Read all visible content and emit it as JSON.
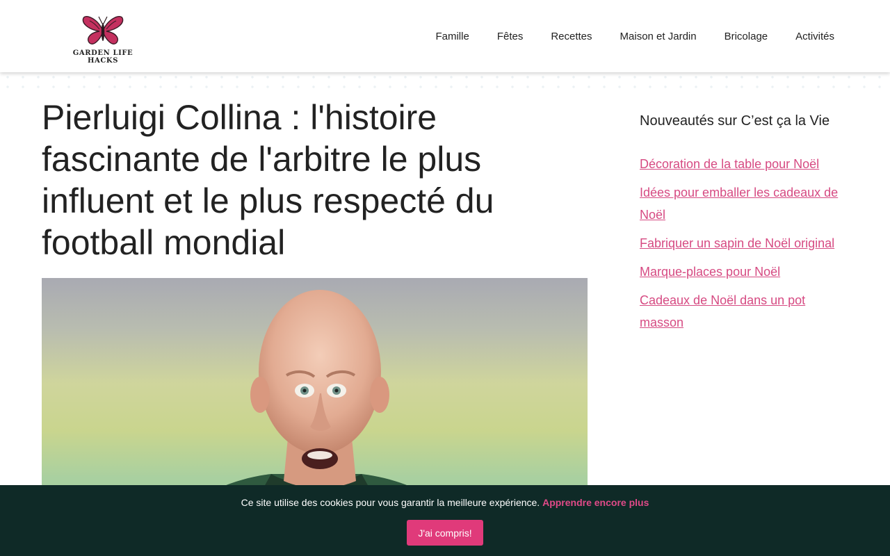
{
  "brand": {
    "logo_text": "GARDEN LIFE HACKS",
    "colors": {
      "accent": "#e03a7a",
      "link": "#d64a82",
      "cookie_bg": "#0f2a27"
    }
  },
  "nav": {
    "items": [
      {
        "label": "Famille"
      },
      {
        "label": "Fêtes"
      },
      {
        "label": "Recettes"
      },
      {
        "label": "Maison et Jardin"
      },
      {
        "label": "Bricolage"
      },
      {
        "label": "Activités"
      }
    ]
  },
  "article": {
    "title": "Pierluigi Collina : l'histoire fascinante de l'arbitre le plus influent et le plus respecté du football mondial"
  },
  "sidebar": {
    "title": "Nouveautés sur C’est ça la Vie",
    "links": [
      {
        "label": "Décoration de la table pour Noël"
      },
      {
        "label": "Idées pour emballer les cadeaux de Noël"
      },
      {
        "label": "Fabriquer un sapin de Noël original"
      },
      {
        "label": "Marque-places pour Noël"
      },
      {
        "label": "Cadeaux de Noël dans un pot masson"
      }
    ]
  },
  "cookie": {
    "text": "Ce site utilise des cookies pour vous garantir la meilleure expérience.",
    "link_label": "Apprendre encore plus",
    "button_label": "J'ai compris!"
  }
}
